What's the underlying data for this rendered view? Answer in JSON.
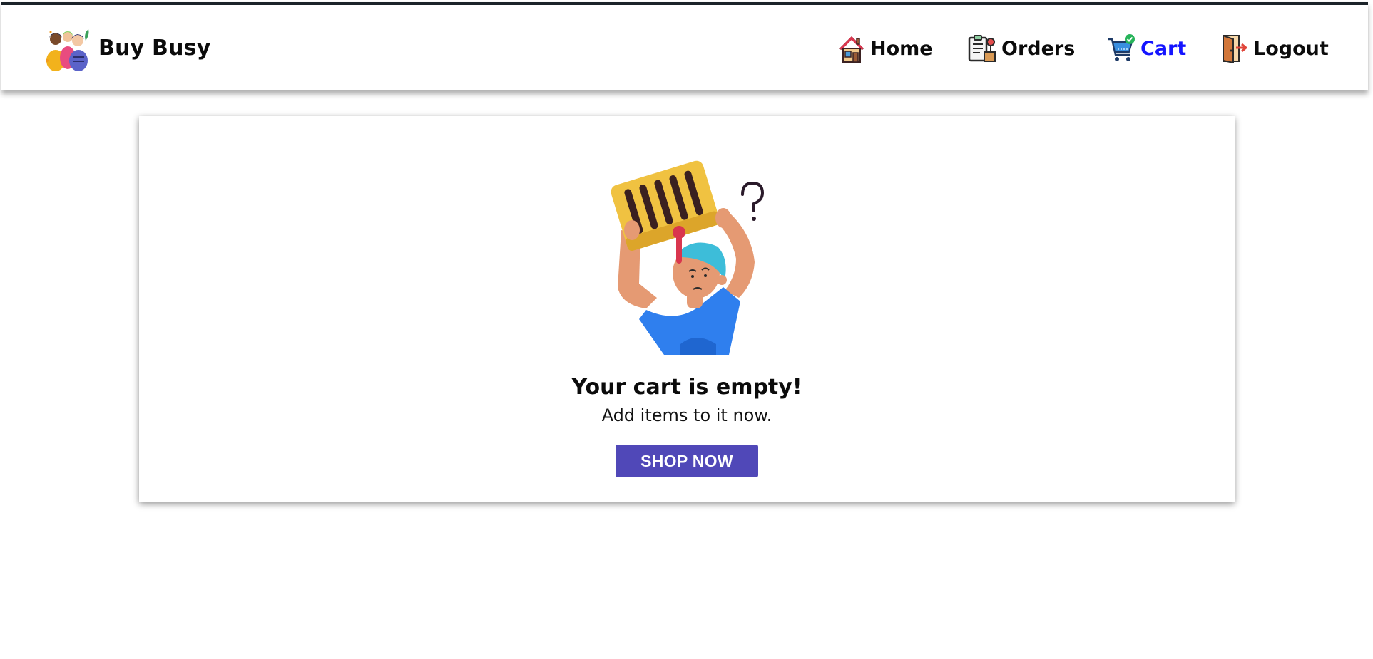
{
  "navbar": {
    "brand": {
      "name": "Buy Busy",
      "logo_icon": "friends-group-logo"
    },
    "items": [
      {
        "label": "Home",
        "icon": "house-icon",
        "active": false
      },
      {
        "label": "Orders",
        "icon": "clipboard-icon",
        "active": false
      },
      {
        "label": "Cart",
        "icon": "shopping-cart-icon",
        "active": true
      },
      {
        "label": "Logout",
        "icon": "exit-door-icon",
        "active": false
      }
    ],
    "active_color": "#1414ff",
    "text_color": "#0b0b0b"
  },
  "empty_cart": {
    "illustration": "confused-person-holding-basket",
    "title": "Your cart is empty!",
    "subtitle": "Add items to it now.",
    "button_label": "SHOP NOW",
    "button_color": "#5048b8"
  }
}
